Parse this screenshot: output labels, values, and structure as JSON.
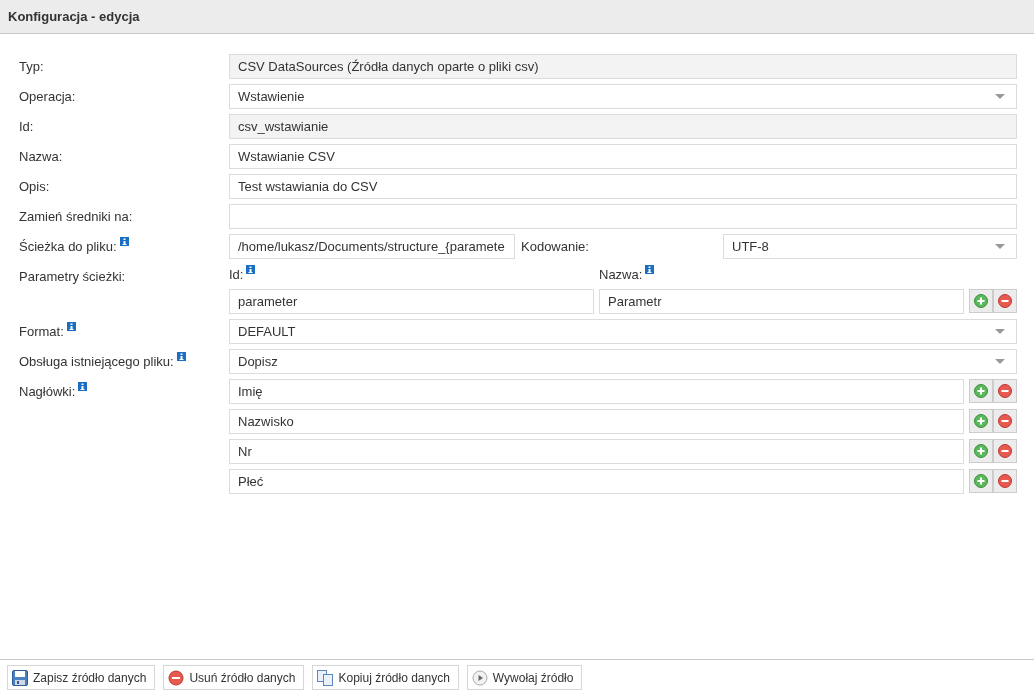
{
  "header": {
    "title": "Konfiguracja - edycja"
  },
  "fields": [
    {
      "kind": "readonly",
      "label": "Typ:",
      "info": false,
      "value": "CSV DataSources (Źródła danych oparte o pliki csv)"
    },
    {
      "kind": "select",
      "label": "Operacja:",
      "info": false,
      "value": "Wstawienie"
    },
    {
      "kind": "readonly",
      "label": "Id:",
      "info": false,
      "value": "csv_wstawianie"
    },
    {
      "kind": "text",
      "label": "Nazwa:",
      "info": false,
      "value": "Wstawianie CSV"
    },
    {
      "kind": "text",
      "label": "Opis:",
      "info": false,
      "value": "Test wstawiania do CSV"
    },
    {
      "kind": "text",
      "label": "Zamień średniki na:",
      "info": false
    },
    {
      "kind": "path",
      "label": "Ścieżka do pliku:",
      "info": true,
      "value": "/home/lukasz/Documents/structure_{paramete",
      "encoding_label": "Kodowanie:",
      "encoding": "UTF-8"
    },
    {
      "kind": "params",
      "label": "Parametry ścieżki:",
      "info": false,
      "id_label": "Id:",
      "name_label": "Nazwa:",
      "rows": [
        {
          "id": "parameter",
          "name": "Parametr"
        }
      ]
    },
    {
      "kind": "select",
      "label": "Format:",
      "info": true,
      "value": "DEFAULT"
    },
    {
      "kind": "select",
      "label": "Obsługa istniejącego pliku:",
      "info": true,
      "value": "Dopisz"
    },
    {
      "kind": "list",
      "label": "Nagłówki:",
      "info": true,
      "items": [
        "Imię",
        "Nazwisko",
        "Nr",
        "Płeć"
      ]
    }
  ],
  "toolbar": [
    {
      "kind": "save",
      "label": "Zapisz źródło danych"
    },
    {
      "kind": "delete",
      "label": "Usuń źródło danych"
    },
    {
      "kind": "copy",
      "label": "Kopiuj źródło danych"
    },
    {
      "kind": "run",
      "label": "Wywołaj źródło"
    }
  ]
}
